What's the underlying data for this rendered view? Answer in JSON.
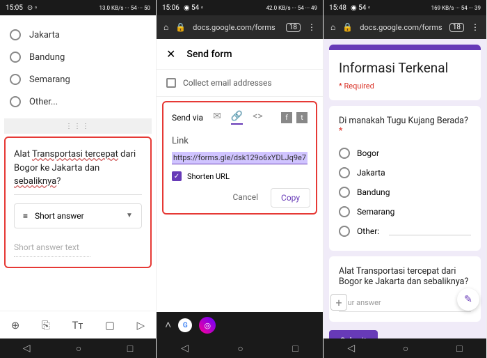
{
  "p1": {
    "time": "15:05",
    "status_right": "13.0 KB/s ··· 54 ··· 50",
    "options": [
      "Jakarta",
      "Bandung",
      "Semarang",
      "Other..."
    ],
    "question": {
      "pre": "Alat ",
      "u1": "Transportasi tercepat",
      "mid": " dari Bogor ke Jakarta dan ",
      "u2": "sebaliknya",
      "post": "?"
    },
    "answer_type": "Short answer",
    "answer_placeholder": "Short answer text",
    "tools": [
      "⊕",
      "⎘",
      "Tᴛ",
      "▢",
      "▷"
    ]
  },
  "p2": {
    "time": "15:06",
    "status_right": "42.0 KB/s ··· 54 ··· 49",
    "url": "docs.google.com/forms",
    "tab_count": "18",
    "send_form": "Send form",
    "collect": "Collect email addresses",
    "send_via": "Send via",
    "link_label": "Link",
    "link_url": "https://forms.gle/dsk129o6xYDLJq9e7",
    "shorten": "Shorten URL",
    "cancel": "Cancel",
    "copy": "Copy"
  },
  "p3": {
    "time": "15:48",
    "status_right": "169 KB/s ··· 54 ··· 39",
    "url": "docs.google.com/forms",
    "tab_count": "18",
    "form_title": "Informasi Terkenal",
    "required": "* Required",
    "q1": "Di manakah Tugu Kujang Berada?",
    "q1_options": [
      "Bogor",
      "Jakarta",
      "Bandung",
      "Semarang"
    ],
    "other": "Other:",
    "q2": "Alat Transportasi tercepat dari Bogor ke Jakarta dan sebaliknya?",
    "your_answer": "Your answer",
    "submit": "Submit"
  }
}
